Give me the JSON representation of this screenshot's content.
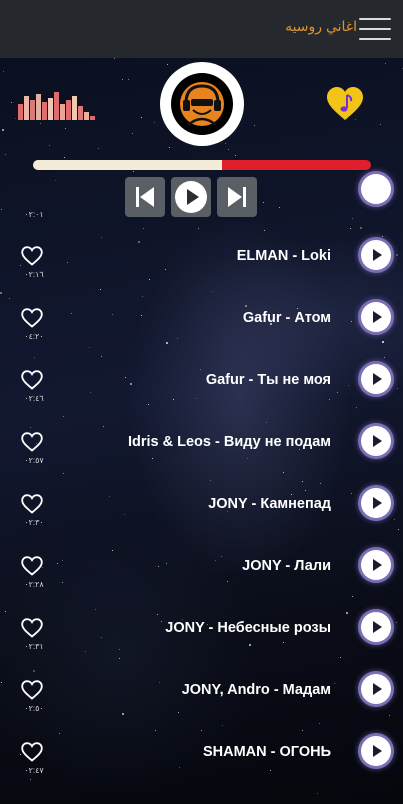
{
  "header": {
    "title": "اغاني روسيه",
    "menu_icon": "hamburger-menu-icon"
  },
  "player": {
    "logo_icon": "headphones-dj-icon",
    "equalizer_icon": "equalizer-bars-icon",
    "favorite_icon": "heart-music-note-icon",
    "progress": 0.56,
    "controls": {
      "prev_icon": "skip-previous-icon",
      "play_icon": "play-icon",
      "next_icon": "skip-next-icon"
    },
    "colors": {
      "progress_played": "#f3ecd9",
      "progress_remaining": "#e01f2c",
      "logo_accent": "#e8841f",
      "heart_gold": "#f2c418"
    }
  },
  "songs": [
    {
      "title": "ELMAN - Loki",
      "duration": "٠٢:١٦"
    },
    {
      "title": "Gafur - Атом",
      "duration": "٠٤:٢٠"
    },
    {
      "title": "Gafur - Ты не моя",
      "duration": "٠٢:٤٦"
    },
    {
      "title": "Idris & Leos - Виду не подам",
      "duration": "٠٢:٥٧"
    },
    {
      "title": "JONY - Камнепад",
      "duration": "٠٢:٣٠"
    },
    {
      "title": "JONY - Лали",
      "duration": "٠٢:٢٨"
    },
    {
      "title": "JONY - Небесные розы",
      "duration": "٠٢:٣١"
    },
    {
      "title": "JONY, Andro - Мадам",
      "duration": "٠٢:٥٠"
    },
    {
      "title": "SHAMAN - ОГОНЬ",
      "duration": "٠٢:٤٧"
    }
  ],
  "partial_row": {
    "duration": "٠٢:٠١"
  }
}
